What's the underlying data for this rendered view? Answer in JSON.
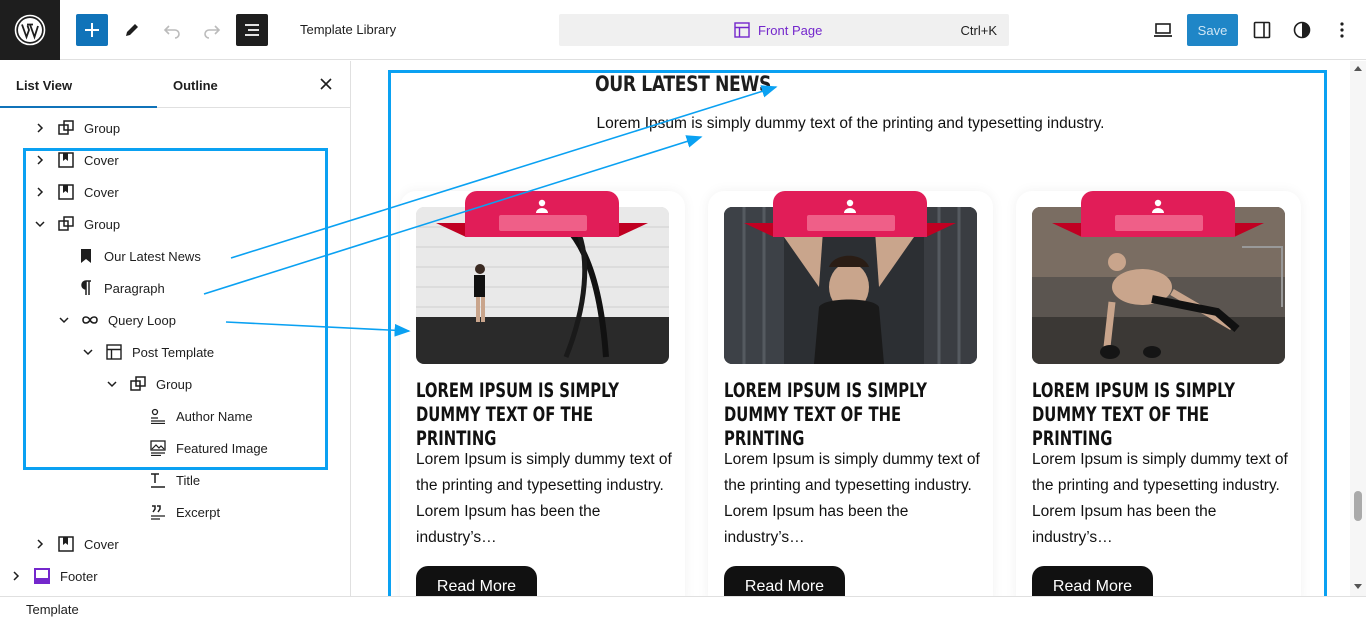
{
  "topbar": {
    "title": "Template Library",
    "command_label": "Front Page",
    "command_shortcut": "Ctrl+K",
    "save_label": "Save",
    "accent": "#1073b9",
    "command_color": "#7427cc"
  },
  "sidebar": {
    "tab_list": "List View",
    "tab_outline": "Outline",
    "items": [
      {
        "label": "Group",
        "icon": "group-icon"
      },
      {
        "label": "Cover",
        "icon": "cover-icon"
      },
      {
        "label": "Cover",
        "icon": "cover-icon"
      },
      {
        "label": "Group",
        "icon": "group-icon"
      },
      {
        "label": "Our Latest News",
        "icon": "bookmark-icon"
      },
      {
        "label": "Paragraph",
        "icon": "paragraph-icon"
      },
      {
        "label": "Query Loop",
        "icon": "loop-icon"
      },
      {
        "label": "Post Template",
        "icon": "layout-icon"
      },
      {
        "label": "Group",
        "icon": "group-icon"
      },
      {
        "label": "Author Name",
        "icon": "author-icon"
      },
      {
        "label": "Featured Image",
        "icon": "image-icon"
      },
      {
        "label": "Title",
        "icon": "title-icon"
      },
      {
        "label": "Excerpt",
        "icon": "excerpt-icon"
      },
      {
        "label": "Cover",
        "icon": "cover-icon"
      },
      {
        "label": "Footer",
        "icon": "footer-icon"
      }
    ]
  },
  "canvas": {
    "heading": "OUR LATEST NEWS",
    "subheading": "Lorem Ipsum is simply dummy text of the printing and typesetting industry.",
    "cards": [
      {
        "title": "LOREM IPSUM IS SIMPLY DUMMY TEXT OF THE PRINTING",
        "excerpt": "Lorem Ipsum is simply dummy text of the printing and typesetting industry. Lorem Ipsum has been the industry’s…",
        "button": "Read More"
      },
      {
        "title": "LOREM IPSUM IS SIMPLY DUMMY TEXT OF THE PRINTING",
        "excerpt": "Lorem Ipsum is simply dummy text of the printing and typesetting industry. Lorem Ipsum has been the industry’s…",
        "button": "Read More"
      },
      {
        "title": "LOREM IPSUM IS SIMPLY DUMMY TEXT OF THE PRINTING",
        "excerpt": "Lorem Ipsum is simply dummy text of the printing and typesetting industry. Lorem Ipsum has been the industry’s…",
        "button": "Read More"
      }
    ],
    "ribbon_color": "#e11d58",
    "highlight_color": "#0aa1f2"
  },
  "footer": {
    "breadcrumb": "Template"
  }
}
